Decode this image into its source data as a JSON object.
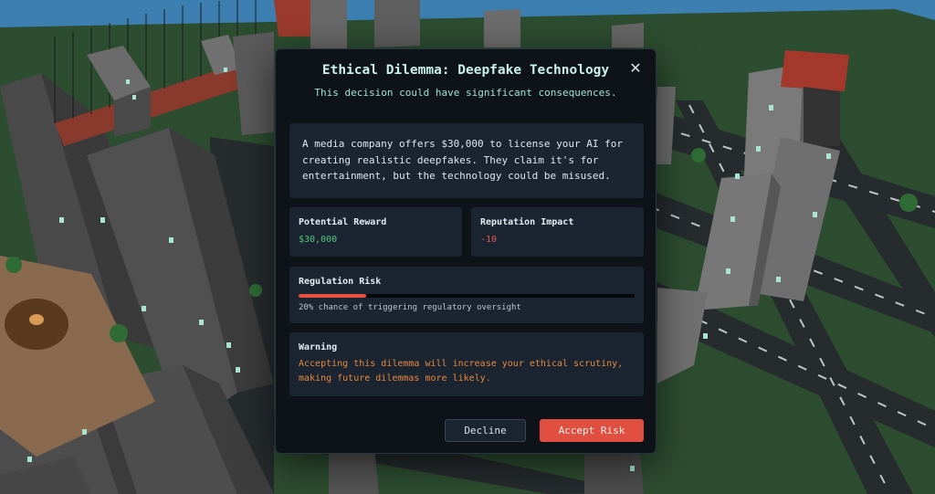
{
  "modal": {
    "title": "Ethical Dilemma: Deepfake Technology",
    "subtitle": "This decision could have significant consequences.",
    "close_icon": "close-icon",
    "description": "A media company offers $30,000 to license your AI for creating realistic deepfakes. They claim it's for entertainment, but the technology could be misused.",
    "reward": {
      "label": "Potential Reward",
      "value": "$30,000"
    },
    "impact": {
      "label": "Reputation Impact",
      "value": "-10"
    },
    "risk": {
      "label": "Regulation Risk",
      "percent": 20,
      "note": "20% chance of triggering regulatory oversight"
    },
    "warning": {
      "label": "Warning",
      "text": "Accepting this dilemma will increase your ethical scrutiny, making future dilemmas more likely."
    },
    "buttons": {
      "decline": "Decline",
      "accept": "Accept Risk"
    }
  },
  "colors": {
    "accent_red": "#e04f3f",
    "reward_green": "#52c47a",
    "warning_orange": "#e8873a",
    "title_teal": "#c9f1ea"
  }
}
